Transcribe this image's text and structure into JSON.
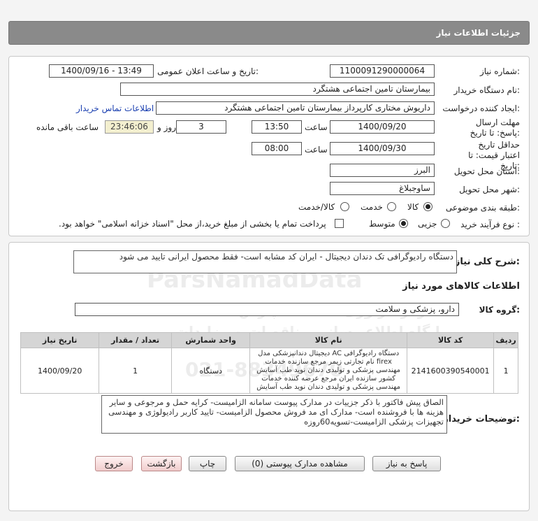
{
  "header": {
    "title": "جزئیات اطلاعات نیاز"
  },
  "labels": {
    "need_number": "شماره نیاز:",
    "announce_datetime": "تاریخ و ساعت اعلان عمومی:",
    "buyer_name": "نام دستگاه خریدار:",
    "requester": "ایجاد کننده درخواست:",
    "send_deadline": "مهلت ارسال پاسخ: تا تاریخ:",
    "time": "ساعت",
    "day_and": "روز و",
    "remaining": "ساعت باقی مانده",
    "price_validity": "حداقل تاریخ اعتبار قیمت: تا تاریخ:",
    "province": "استان محل تحویل:",
    "city": "شهر محل تحویل:",
    "category": "طبقه بندی موضوعی:",
    "purchase_type": "نوع فرآیند خرید :",
    "description": "شرح کلی نیاز:",
    "goods_info": "اطلاعات کالاهای مورد نیاز",
    "goods_group": "گروه کالا:",
    "buyer_notes": "توضیحات خریدار:"
  },
  "form": {
    "need_number": "1100091290000064",
    "announce_datetime": "1400/09/16 - 13:49",
    "buyer_name": "بیمارستان تامین اجتماعی هشتگرد",
    "requester": "داریوش مختاری کارپرداز بیمارستان تامین اجتماعی هشتگرد",
    "contact_link": "اطلاعات تماس خریدار",
    "deadline_date": "1400/09/20",
    "deadline_time": "13:50",
    "days": "3",
    "countdown": "23:46:06",
    "validity_date": "1400/09/30",
    "validity_time": "08:00",
    "province": "البرز",
    "city": "ساوجبلاغ"
  },
  "category_options": [
    "کالا",
    "خدمت",
    "کالا/خدمت"
  ],
  "category_selected": "کالا",
  "purchase_options": [
    "جزیی",
    "متوسط"
  ],
  "purchase_selected": "متوسط",
  "payment_note": "پرداخت تمام یا بخشی از مبلغ خرید،از محل \"اسناد خزانه اسلامی\" خواهد بود.",
  "description": "دستگاه رادیوگرافی تک دندان دیجیتال - ایران کد مشابه است- فقط محصول ایرانی تایید می شود",
  "goods_group": "دارو، پزشکی و سلامت",
  "table": {
    "headers": [
      "ردیف",
      "کد کالا",
      "نام کالا",
      "واحد شمارش",
      "تعداد / مقدار",
      "تاریخ نیاز"
    ],
    "rows": [
      {
        "row": "1",
        "code": "2141600390540001",
        "name": "دستگاه رادیوگرافی AC دیجیتال دندانپزشکی مدل firex نام تجارتی زیمر مرجع سازنده خدمات مهندسی پزشکی و تولیدی دندان نوید طب آسایش کشور سازنده ایران مرجع عرضه کننده خدمات مهندسی پزشکی و تولیدی دندان نوید طب آسایش",
        "unit": "دستگاه",
        "qty": "1",
        "date": "1400/09/20"
      }
    ]
  },
  "buyer_notes": "الصاق پیش فاکتور با ذکر جزییات در مدارک پیوست سامانه الزامیست- کرایه حمل و مرجوعی و سایر هزینه ها با فروشنده است- مدارک ای مد فروش محصول الزامیست- تایید کاربر رادیولوژی و مهندسی تجهیزات پزشکی الزامیست-تسویه60روزه",
  "buttons": {
    "reply": "پاسخ به نیاز",
    "view_docs": "مشاهده مدارک پیوستی (0)",
    "print": "چاپ",
    "back": "بازگشت",
    "exit": "خروج"
  },
  "watermark": {
    "brand": "ParsNamadData",
    "line1": "مرکز فراوری اطلاعات پارس نماد داده",
    "line2": "پایگاه اطلاع رسانی مناقصات و مزایدات",
    "phone": "021-88349670"
  }
}
